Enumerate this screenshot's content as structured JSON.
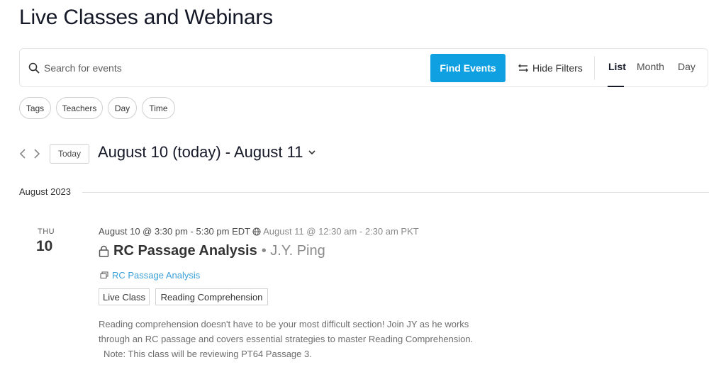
{
  "page": {
    "title": "Live Classes and Webinars"
  },
  "search": {
    "placeholder": "Search for events",
    "value": "",
    "find_label": "Find Events",
    "hide_filters_label": "Hide Filters",
    "views": [
      "List",
      "Month",
      "Day"
    ],
    "active_view": "List"
  },
  "filters": [
    "Tags",
    "Teachers",
    "Day",
    "Time"
  ],
  "nav": {
    "today_label": "Today",
    "date_range": "August 10 (today) - August 11"
  },
  "month_separator": "August 2023",
  "events": [
    {
      "day_name": "THU",
      "day_num": "10",
      "time": "August 10 @ 3:30 pm - 5:30 pm EDT",
      "alt_time": "August 11 @ 12:30 am - 2:30 am PKT",
      "title": "RC Passage Analysis",
      "teacher": "• J.Y. Ping",
      "series": "RC Passage Analysis",
      "tags": [
        "Live Class",
        "Reading Comprehension"
      ],
      "description_line1": "Reading comprehension doesn't have to be your most difficult section! Join JY as he works through an RC passage and covers essential strategies to master Reading Comprehension.",
      "description_line2": "Note: This class will be reviewing PT64 Passage 3."
    }
  ],
  "colors": {
    "accent": "#0ea0e0",
    "link": "#3aa0d8",
    "text": "#141827",
    "muted": "#8a8a8a"
  }
}
